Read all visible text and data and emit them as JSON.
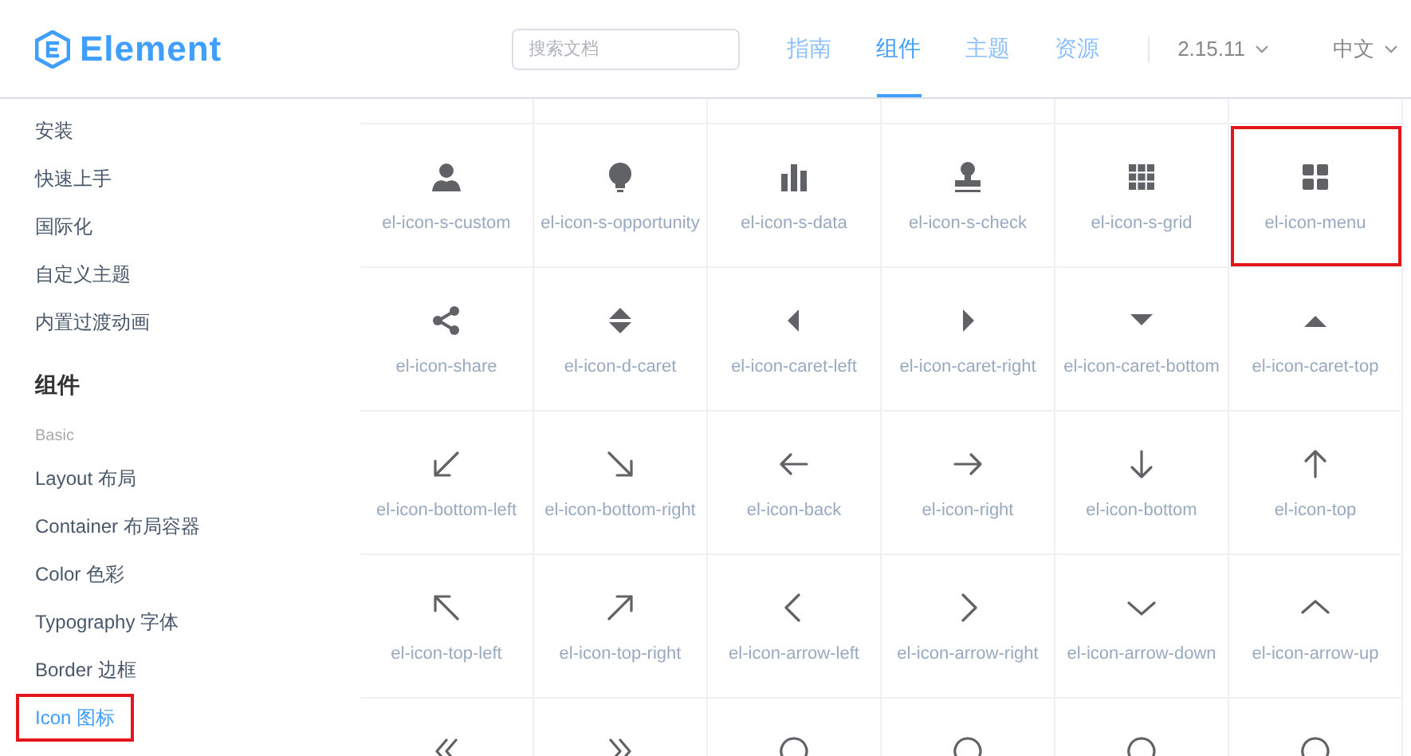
{
  "header": {
    "logo_text": "Element",
    "search": {
      "placeholder": "搜索文档"
    },
    "nav": [
      {
        "label": "指南",
        "selected": false
      },
      {
        "label": "组件",
        "selected": true
      },
      {
        "label": "主题",
        "selected": false
      },
      {
        "label": "资源",
        "selected": false
      }
    ],
    "version": "2.15.11",
    "language": "中文"
  },
  "sidebar": {
    "items": [
      {
        "label": "安装",
        "selected": false
      },
      {
        "label": "快速上手",
        "selected": false
      },
      {
        "label": "国际化",
        "selected": false
      },
      {
        "label": "自定义主题",
        "selected": false
      },
      {
        "label": "内置过渡动画",
        "selected": false
      }
    ],
    "section_title": "组件",
    "group_label": "Basic",
    "group_items": [
      {
        "label": "Layout 布局",
        "selected": false,
        "highlighted": false
      },
      {
        "label": "Container 布局容器",
        "selected": false,
        "highlighted": false
      },
      {
        "label": "Color 色彩",
        "selected": false,
        "highlighted": false
      },
      {
        "label": "Typography 字体",
        "selected": false,
        "highlighted": false
      },
      {
        "label": "Border 边框",
        "selected": false,
        "highlighted": false
      },
      {
        "label": "Icon 图标",
        "selected": true,
        "highlighted": true
      }
    ]
  },
  "icons": [
    {
      "kind": "user",
      "label": "el-icon-s-custom",
      "highlighted": false
    },
    {
      "kind": "bulb",
      "label": "el-icon-s-opportunity",
      "highlighted": false
    },
    {
      "kind": "bars",
      "label": "el-icon-s-data",
      "highlighted": false
    },
    {
      "kind": "stamp",
      "label": "el-icon-s-check",
      "highlighted": false
    },
    {
      "kind": "grid9",
      "label": "el-icon-s-grid",
      "highlighted": false
    },
    {
      "kind": "grid4",
      "label": "el-icon-menu",
      "highlighted": true
    },
    {
      "kind": "share",
      "label": "el-icon-share",
      "highlighted": false
    },
    {
      "kind": "d-caret",
      "label": "el-icon-d-caret",
      "highlighted": false
    },
    {
      "kind": "caret-left",
      "label": "el-icon-caret-left",
      "highlighted": false
    },
    {
      "kind": "caret-right",
      "label": "el-icon-caret-right",
      "highlighted": false
    },
    {
      "kind": "caret-bottom",
      "label": "el-icon-caret-bottom",
      "highlighted": false
    },
    {
      "kind": "caret-top",
      "label": "el-icon-caret-top",
      "highlighted": false
    },
    {
      "kind": "bottom-left",
      "label": "el-icon-bottom-left",
      "highlighted": false
    },
    {
      "kind": "bottom-right",
      "label": "el-icon-bottom-right",
      "highlighted": false
    },
    {
      "kind": "back",
      "label": "el-icon-back",
      "highlighted": false
    },
    {
      "kind": "right",
      "label": "el-icon-right",
      "highlighted": false
    },
    {
      "kind": "bottom",
      "label": "el-icon-bottom",
      "highlighted": false
    },
    {
      "kind": "top",
      "label": "el-icon-top",
      "highlighted": false
    },
    {
      "kind": "top-left",
      "label": "el-icon-top-left",
      "highlighted": false
    },
    {
      "kind": "top-right",
      "label": "el-icon-top-right",
      "highlighted": false
    },
    {
      "kind": "arrow-left",
      "label": "el-icon-arrow-left",
      "highlighted": false
    },
    {
      "kind": "arrow-right",
      "label": "el-icon-arrow-right",
      "highlighted": false
    },
    {
      "kind": "arrow-down",
      "label": "el-icon-arrow-down",
      "highlighted": false
    },
    {
      "kind": "arrow-up",
      "label": "el-icon-arrow-up",
      "highlighted": false
    },
    {
      "kind": "d-arrow-left",
      "highlighted": false
    },
    {
      "kind": "d-arrow-right",
      "highlighted": false
    },
    {
      "kind": "circle",
      "highlighted": false
    },
    {
      "kind": "circle",
      "highlighted": false
    },
    {
      "kind": "circle",
      "highlighted": false
    },
    {
      "kind": "circle",
      "highlighted": false
    }
  ]
}
